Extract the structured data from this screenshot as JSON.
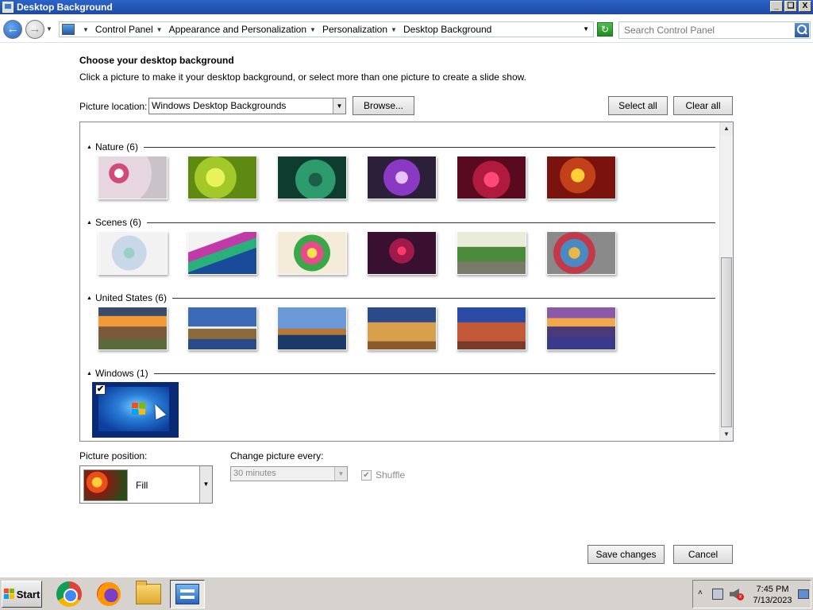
{
  "window": {
    "title": "Desktop Background",
    "controls": {
      "minimize": "_",
      "maximize": "❏",
      "close": "X"
    }
  },
  "address_bar": {
    "breadcrumbs": [
      "Control Panel",
      "Appearance and Personalization",
      "Personalization",
      "Desktop Background"
    ],
    "search_placeholder": "Search Control Panel"
  },
  "main": {
    "heading": "Choose your desktop background",
    "subtitle": "Click a picture to make it your desktop background, or select more than one picture to create a slide show.",
    "picture_location_label": "Picture location:",
    "picture_location_value": "Windows Desktop Backgrounds",
    "browse_label": "Browse...",
    "select_all_label": "Select all",
    "clear_all_label": "Clear all",
    "groups": [
      {
        "label": "Nature (6)",
        "tiles": [
          {
            "bg": "radial-gradient(circle at 30% 40%, #ffffff 0 8%, #d24a7a 9% 18%, #e6d6e0 19% 60%, #c9c2c9 61%)"
          },
          {
            "bg": "radial-gradient(circle at 40% 50%, #e8f35a 0 20%, #a3c829 21% 45%, #5f8a12 46%)"
          },
          {
            "bg": "radial-gradient(circle at 55% 55%, #1b5f4a 0 15%, #2e9b6c 16% 45%, #0e3d30 46%)"
          },
          {
            "bg": "radial-gradient(circle at 50% 50%, #e6c2ff 0 15%, #8a3ac2 16% 45%, #2b1f3a 46%)"
          },
          {
            "bg": "radial-gradient(circle at 50% 55%, #ff4a78 0 18%, #b01a3d 19% 45%, #5a0a1f 46%)"
          },
          {
            "bg": "radial-gradient(circle at 45% 45%, #ffcf3a 0 15%, #c2401a 16% 40%, #7a120e 41%)"
          }
        ]
      },
      {
        "label": "Scenes (6)",
        "tiles": [
          {
            "bg": "radial-gradient(circle at 45% 50%, #9ad0c4 0 12%, #c8d8e8 13% 40%, #f2f2f2 41%)"
          },
          {
            "bg": "linear-gradient(160deg, #f2f2f2 0 30%, #c23aa8 31% 45%, #2ab07a 46% 60%, #1a4a9a 61%)"
          },
          {
            "bg": "radial-gradient(circle at 50% 50%, #ffe14a 0 12%, #e84a8a 13% 28%, #3aa84a 29% 45%, #f4ecd8 46%)"
          },
          {
            "bg": "radial-gradient(circle at 50% 45%, #ff3a6a 0 10%, #a01a4a 11% 30%, #3a1030 31%)"
          },
          {
            "bg": "linear-gradient(180deg, #e8ecd8 0 35%, #4a8a3a 36% 70%, #7a7a6a 71%)"
          },
          {
            "bg": "radial-gradient(circle at 40% 50%, #e8b84a 0 12%, #4a8ac2 13% 30%, #c23a4a 31% 45%, #8a8a8a 46%)"
          }
        ]
      },
      {
        "label": "United States (6)",
        "tiles": [
          {
            "bg": "linear-gradient(180deg, #3a4a6a 0 20%, #f29a3a 21% 45%, #7a5a3a 46% 75%, #5a6a3a 76%)"
          },
          {
            "bg": "linear-gradient(180deg, #3a6ab8 0 45%, #f2f2f2 46% 50%, #8a6a3a 51% 75%, #2a4a8a 76%)"
          },
          {
            "bg": "linear-gradient(180deg, #6a9ad8 0 50%, #b8763a 51% 65%, #1a3a6a 66%)"
          },
          {
            "bg": "linear-gradient(180deg, #2a4a8a 0 35%, #d8a04a 36% 80%, #8a5a2a 81%)"
          },
          {
            "bg": "linear-gradient(180deg, #2a4aa8 0 35%, #c25a3a 36% 80%, #7a3a2a 81%)"
          },
          {
            "bg": "linear-gradient(180deg, #8a5aa8 0 25%, #f2a84a 26% 45%, #4a3a7a 46% 70%, #3a3a8a 71%)"
          }
        ]
      },
      {
        "label": "Windows (1)",
        "tiles": []
      }
    ],
    "selected_tile_checkmark": "✔"
  },
  "bottom": {
    "picture_position_label": "Picture position:",
    "picture_position_value": "Fill",
    "change_every_label": "Change picture every:",
    "change_every_value": "30 minutes",
    "shuffle_label": "Shuffle",
    "shuffle_checked": true,
    "save_label": "Save changes",
    "cancel_label": "Cancel"
  },
  "taskbar": {
    "start_label": "Start",
    "apps": [
      "chrome-icon",
      "firefox-icon",
      "file-explorer-icon",
      "control-panel-icon"
    ],
    "clock_time": "7:45 PM",
    "clock_date": "7/13/2023"
  }
}
